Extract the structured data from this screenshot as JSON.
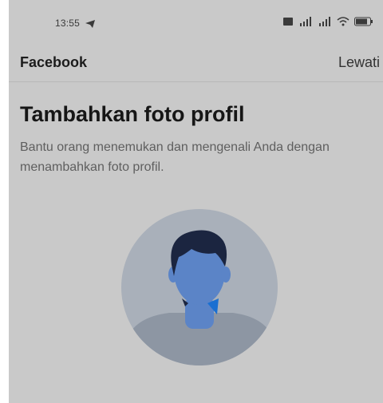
{
  "status_bar": {
    "time": "13:55"
  },
  "header": {
    "title": "Facebook",
    "skip_label": "Lewati"
  },
  "main": {
    "heading": "Tambahkan foto profil",
    "subtitle": "Bantu orang menemukan dan mengenali Anda dengan menambahkan foto profil."
  },
  "colors": {
    "overlay_bg": "#c9c9c9",
    "avatar_bg": "#a9b0ba",
    "face": "#5b84c7",
    "hair": "#1b2540",
    "accent": "#1a6fd1"
  }
}
